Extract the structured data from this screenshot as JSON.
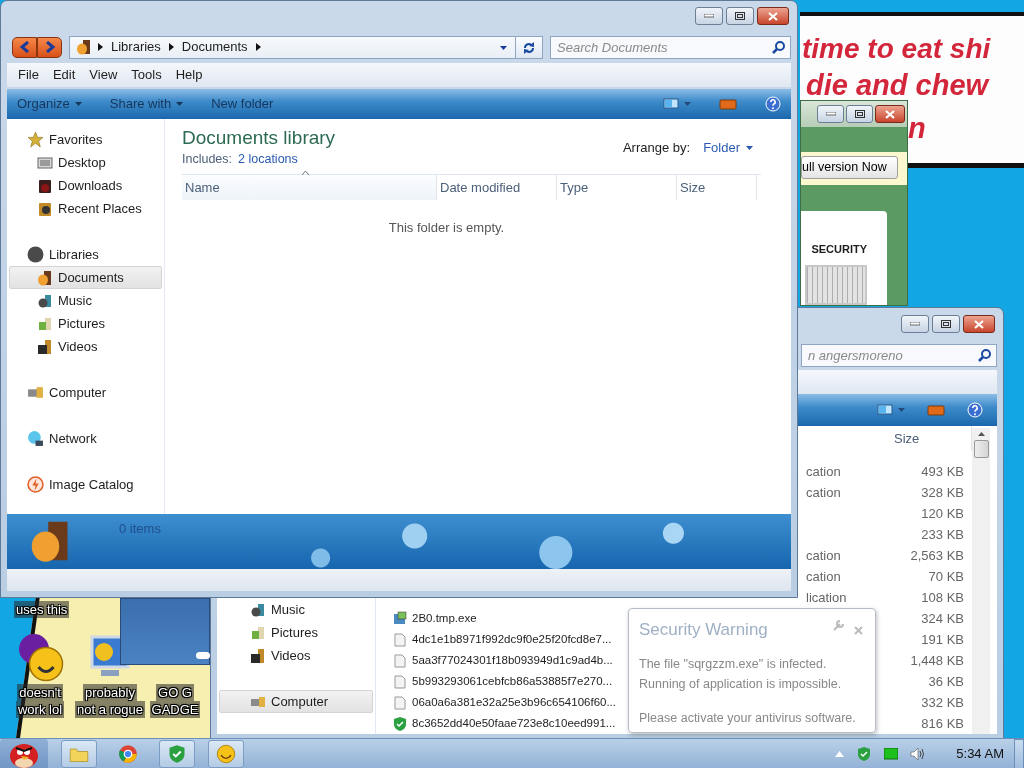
{
  "wallpaper_note": {
    "lines": [
      "time to eat shi",
      "die and chew",
      "n"
    ]
  },
  "fake_antivirus": {
    "button": "ull version Now",
    "label": "SECURITY"
  },
  "desktop": {
    "caption": "uses this",
    "icons": [
      {
        "kind": "messenger",
        "lines": [
          "doesn't",
          "work lol"
        ]
      },
      {
        "kind": "monitor",
        "lines": [
          "probably",
          "not a rogue"
        ]
      },
      {
        "kind": "hidden",
        "lines": [
          "GO G",
          "GADGE"
        ]
      }
    ]
  },
  "back_window": {
    "search": {
      "placeholder": "n angersmoreno"
    },
    "size_header": "Size",
    "sidebar": [
      {
        "label": "Music",
        "kind": "music",
        "selected": false
      },
      {
        "label": "Pictures",
        "kind": "pictures",
        "selected": false
      },
      {
        "label": "Videos",
        "kind": "videos",
        "selected": false
      },
      {
        "label": "Computer",
        "kind": "computer",
        "selected": true
      }
    ],
    "rows": [
      {
        "type": "cation",
        "size": "493 KB"
      },
      {
        "type": "cation",
        "size": "328 KB"
      },
      {
        "size": "120 KB"
      },
      {
        "size": "233 KB"
      },
      {
        "type": "cation",
        "size": "2,563 KB"
      },
      {
        "type": "cation",
        "size": "70 KB"
      },
      {
        "type": "lication",
        "size": "108 KB"
      },
      {
        "kind": "exe",
        "name": "2B0.tmp.exe",
        "size": "324 KB"
      },
      {
        "kind": "file",
        "name": "4dc1e1b8971f992dc9f0e25f20fcd8e7...",
        "size": "191 KB"
      },
      {
        "kind": "file",
        "name": "5aa3f77024301f18b093949d1c9ad4b...",
        "size": "1,448 KB"
      },
      {
        "kind": "file",
        "name": "5b993293061cebfcb86a53885f7e270...",
        "size": "36 KB"
      },
      {
        "kind": "file",
        "name": "06a0a6a381e32a25e3b96c654106f60...",
        "size": "332 KB"
      },
      {
        "kind": "shield",
        "name": "8c3652dd40e50faae723e8c10eed991...",
        "size": "816 KB"
      }
    ]
  },
  "main_window": {
    "breadcrumb": [
      "Libraries",
      "Documents"
    ],
    "search": {
      "placeholder": "Search Documents"
    },
    "menu": [
      "File",
      "Edit",
      "View",
      "Tools",
      "Help"
    ],
    "toolbar": [
      {
        "label": "Organize",
        "dropdown": true
      },
      {
        "label": "Share with",
        "dropdown": true
      },
      {
        "label": "New folder",
        "dropdown": false
      }
    ],
    "sidebar": [
      {
        "label": "Favorites",
        "kind": "favorites",
        "selected": false,
        "children": [
          {
            "label": "Desktop",
            "kind": "desktop",
            "selected": false
          },
          {
            "label": "Downloads",
            "kind": "downloads",
            "selected": false
          },
          {
            "label": "Recent Places",
            "kind": "recent",
            "selected": false
          }
        ]
      },
      {
        "label": "Libraries",
        "kind": "libraries",
        "selected": false,
        "children": [
          {
            "label": "Documents",
            "kind": "documents",
            "selected": true
          },
          {
            "label": "Music",
            "kind": "music",
            "selected": false
          },
          {
            "label": "Pictures",
            "kind": "pictures",
            "selected": false
          },
          {
            "label": "Videos",
            "kind": "videos",
            "selected": false
          }
        ]
      },
      {
        "label": "Computer",
        "kind": "computer",
        "selected": false
      },
      {
        "label": "Network",
        "kind": "network",
        "selected": false
      },
      {
        "label": "Image Catalog",
        "kind": "catalog",
        "selected": false
      }
    ],
    "library": {
      "title": "Documents library",
      "includes_label": "Includes:",
      "includes_link": "2 locations",
      "arrange_label": "Arrange by:",
      "arrange_value": "Folder"
    },
    "columns": [
      {
        "label": "Name",
        "sorted": true
      },
      {
        "label": "Date modified",
        "sorted": false
      },
      {
        "label": "Type",
        "sorted": false
      },
      {
        "label": "Size",
        "sorted": false
      }
    ],
    "empty_message": "This folder is empty.",
    "status": "0 items"
  },
  "balloon": {
    "title": "Security Warning",
    "lines": [
      "The file \"sqrgzzm.exe\" is infected.",
      "Running of application is impossible.",
      "Please activate your antivirus software."
    ]
  },
  "taskbar": {
    "buttons": [
      {
        "kind": "folder",
        "running": true
      },
      {
        "kind": "browser",
        "running": false
      },
      {
        "kind": "shield",
        "running": true
      },
      {
        "kind": "emoji",
        "running": true
      }
    ],
    "clock": "5:34 AM"
  }
}
